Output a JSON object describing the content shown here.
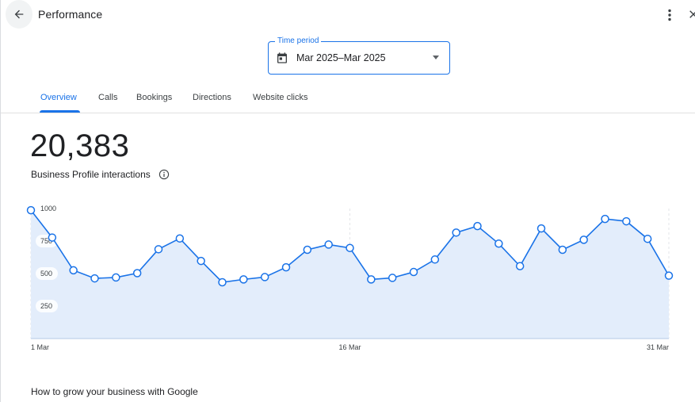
{
  "header": {
    "title": "Performance",
    "back_icon": "arrow-back-icon",
    "more_icon": "more-vert-icon",
    "close_icon": "close-icon"
  },
  "time_period": {
    "label": "Time period",
    "value": "Mar 2025–Mar 2025",
    "icon": "calendar-icon"
  },
  "tabs": [
    {
      "label": "Overview",
      "active": true
    },
    {
      "label": "Calls",
      "active": false
    },
    {
      "label": "Bookings",
      "active": false
    },
    {
      "label": "Directions",
      "active": false
    },
    {
      "label": "Website clicks",
      "active": false
    }
  ],
  "metric": {
    "value": "20,383",
    "label": "Business Profile interactions",
    "info_icon": "info-icon"
  },
  "colors": {
    "accent": "#1a73e8",
    "area_fill": "#e3edfb",
    "text": "#202124"
  },
  "chart_data": {
    "type": "area",
    "x": [
      "1 Mar",
      "2 Mar",
      "3 Mar",
      "4 Mar",
      "5 Mar",
      "6 Mar",
      "7 Mar",
      "8 Mar",
      "9 Mar",
      "10 Mar",
      "11 Mar",
      "12 Mar",
      "13 Mar",
      "14 Mar",
      "15 Mar",
      "16 Mar",
      "17 Mar",
      "18 Mar",
      "19 Mar",
      "20 Mar",
      "21 Mar",
      "22 Mar",
      "23 Mar",
      "24 Mar",
      "25 Mar",
      "26 Mar",
      "27 Mar",
      "28 Mar",
      "29 Mar",
      "30 Mar",
      "31 Mar"
    ],
    "y": [
      987,
      777,
      525,
      463,
      470,
      503,
      687,
      770,
      597,
      433,
      455,
      473,
      548,
      683,
      723,
      697,
      455,
      467,
      512,
      608,
      815,
      865,
      730,
      557,
      847,
      683,
      760,
      920,
      902,
      767,
      484
    ],
    "x_tick_labels": [
      "1 Mar",
      "16 Mar",
      "31 Mar"
    ],
    "y_tick_labels": [
      "1000",
      "750",
      "500",
      "250"
    ],
    "ylim": [
      0,
      1000
    ],
    "grid": false
  },
  "section": {
    "title": "How to grow your business with Google"
  }
}
